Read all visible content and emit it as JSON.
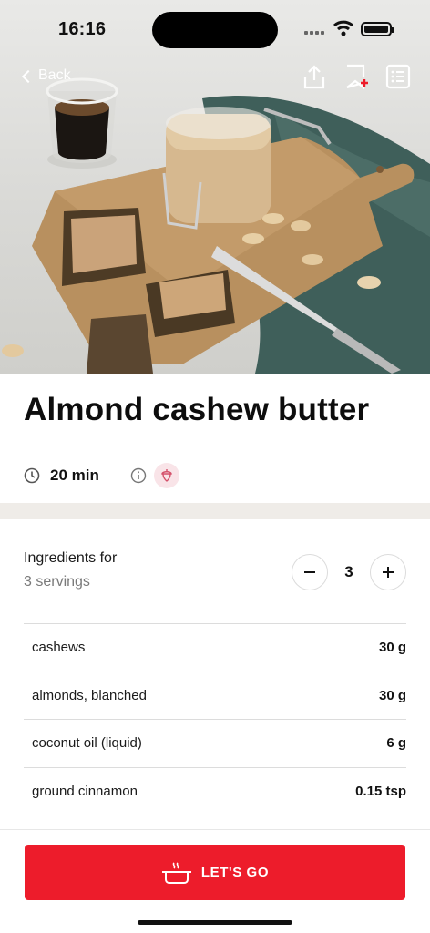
{
  "status_bar": {
    "time": "16:16"
  },
  "nav": {
    "back_label": "Back",
    "icons": [
      "share-icon",
      "bookmark-add-icon",
      "shopping-list-icon"
    ]
  },
  "hero": {
    "image": "photo-nut-butter-jar-on-cutting-board"
  },
  "recipe": {
    "title": "Almond cashew butter",
    "duration": "20 min",
    "diet_icon": "acorn-icon"
  },
  "ingredients": {
    "heading": "Ingredients for",
    "servings_label": "3 servings",
    "count": "3",
    "items": [
      {
        "name": "cashews",
        "qty": "30 g"
      },
      {
        "name": "almonds, blanched",
        "qty": "30 g"
      },
      {
        "name": "coconut oil (liquid)",
        "qty": "6 g"
      },
      {
        "name": "ground cinnamon",
        "qty": "0.15 tsp"
      }
    ]
  },
  "cta": {
    "label": "LET'S GO",
    "icon": "cooking-pot-icon"
  },
  "colors": {
    "accent": "#ed1c2b",
    "badge_bg": "#f9e4e8",
    "band": "#efece8"
  }
}
